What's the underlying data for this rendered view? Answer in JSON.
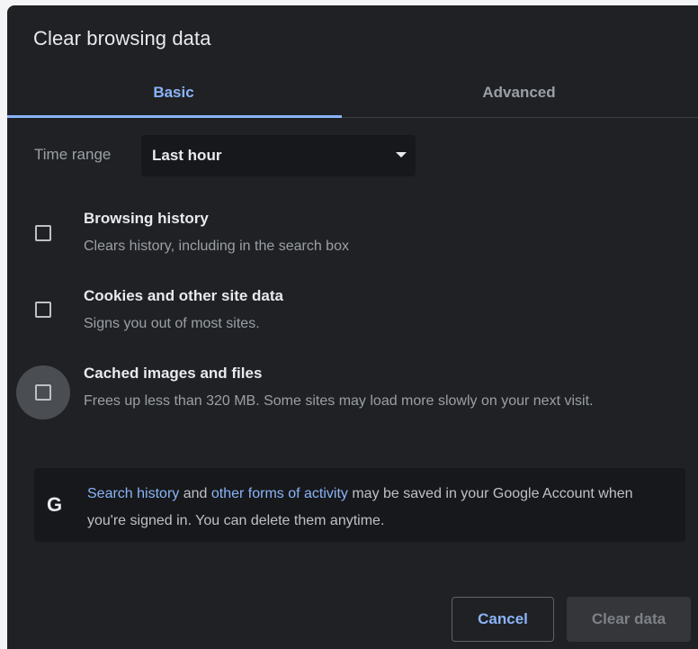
{
  "dialog": {
    "title": "Clear browsing data"
  },
  "tabs": [
    {
      "label": "Basic",
      "selected": true
    },
    {
      "label": "Advanced",
      "selected": false
    }
  ],
  "time_range": {
    "label": "Time range",
    "value": "Last hour"
  },
  "options": [
    {
      "title": "Browsing history",
      "description": "Clears history, including in the search box",
      "checked": false
    },
    {
      "title": "Cookies and other site data",
      "description": "Signs you out of most sites.",
      "checked": false
    },
    {
      "title": "Cached images and files",
      "description": "Frees up less than 320 MB. Some sites may load more slowly on your next visit.",
      "checked": false
    }
  ],
  "info": {
    "icon": "google-g-icon",
    "link1": "Search history",
    "text1": " and ",
    "link2": "other forms of activity",
    "text2": " may be saved in your Google Account when you're signed in. You can delete them anytime."
  },
  "buttons": {
    "cancel": "Cancel",
    "clear": "Clear data"
  },
  "colors": {
    "background": "#202124",
    "accent": "#8ab4f8",
    "text": "#e8eaed",
    "secondary_text": "#9aa0a6"
  }
}
